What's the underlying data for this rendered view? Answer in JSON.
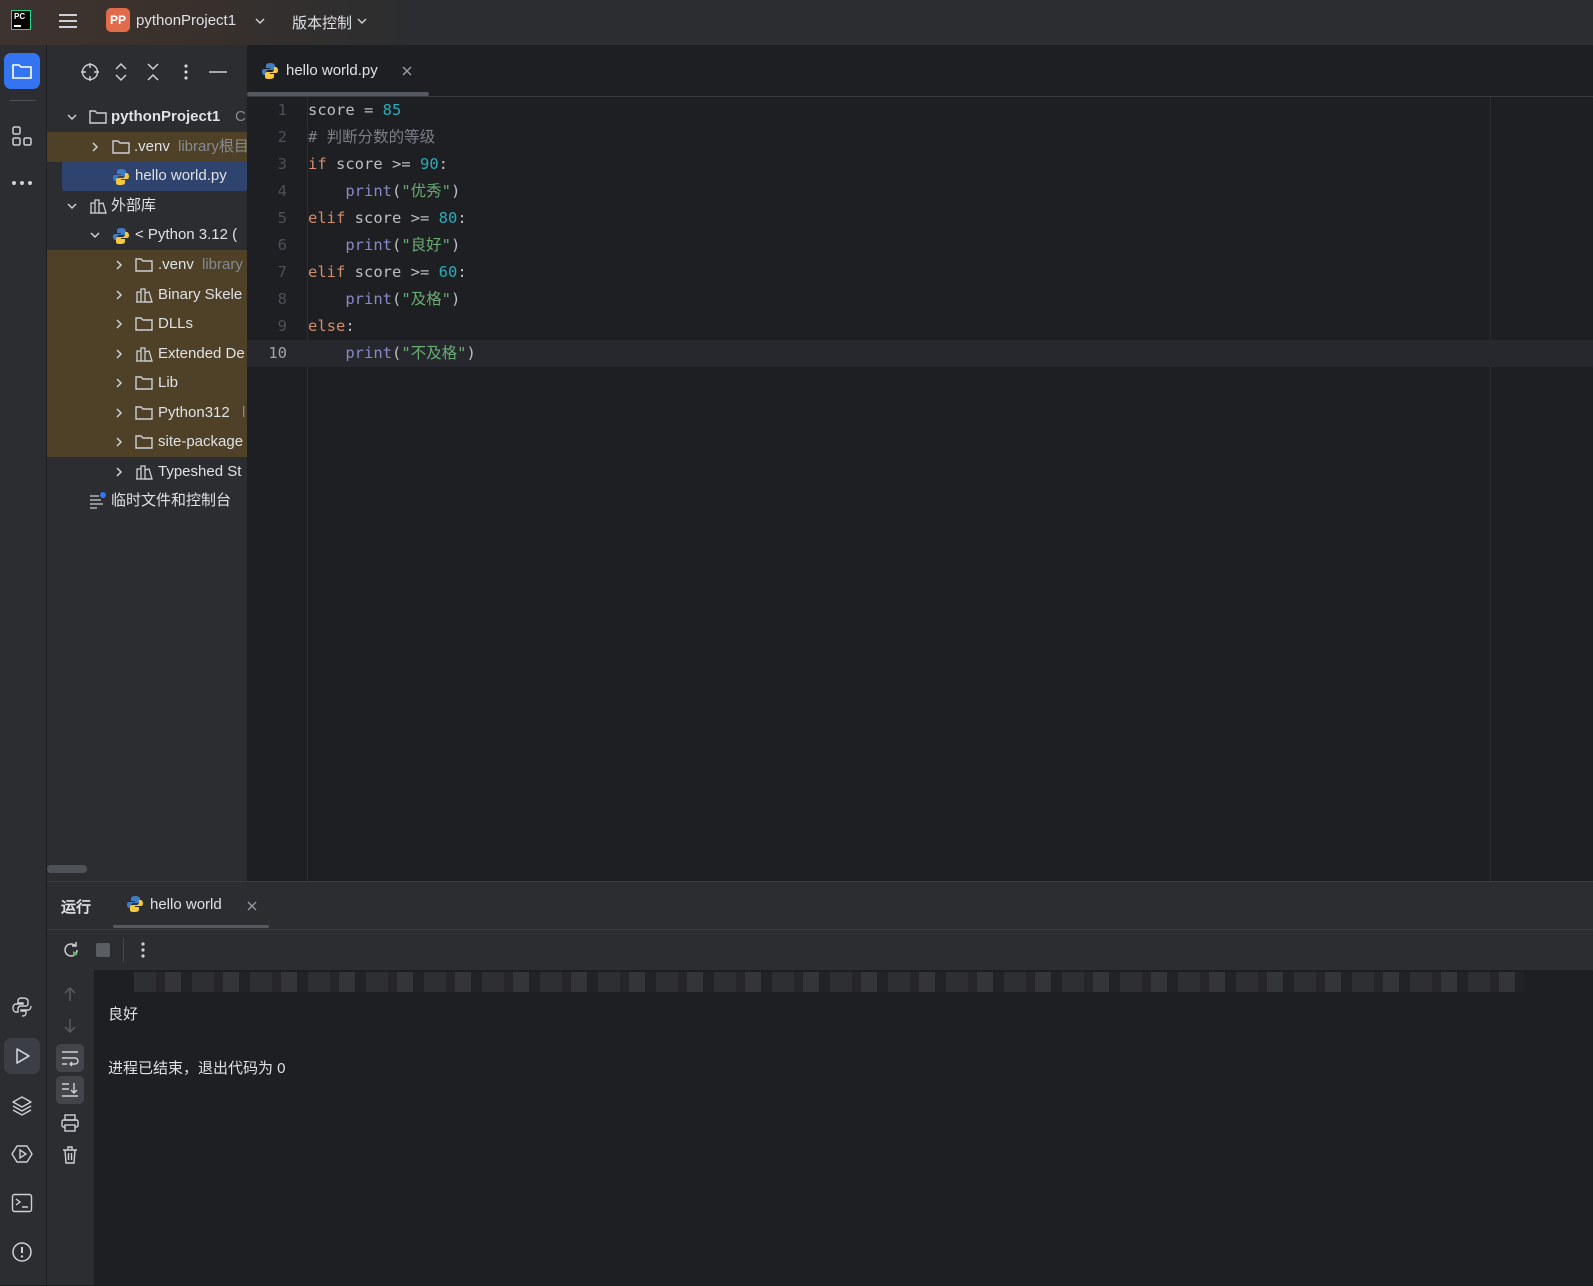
{
  "titlebar": {
    "logo_text": "PC",
    "project_badge": "PP",
    "project_name": "pythonProject1",
    "vcs_menu": "版本控制"
  },
  "project_tree": {
    "root": {
      "label": "pythonProject1",
      "suffix": "C"
    },
    "items": [
      {
        "label": ".venv",
        "suffix": "library根目"
      },
      {
        "label": "hello world.py"
      },
      {
        "label": "外部库"
      },
      {
        "label": "< Python 3.12 ("
      },
      {
        "label": ".venv",
        "suffix": "library"
      },
      {
        "label": "Binary Skele"
      },
      {
        "label": "DLLs"
      },
      {
        "label": "Extended De"
      },
      {
        "label": "Lib"
      },
      {
        "label": "Python312",
        "suffix": "l"
      },
      {
        "label": "site-package"
      },
      {
        "label": "Typeshed St"
      },
      {
        "label": "临时文件和控制台"
      }
    ]
  },
  "editor": {
    "tab_label": "hello world.py",
    "current_line": 10,
    "lines": [
      {
        "n": "1",
        "tokens": [
          [
            "pl",
            "score = "
          ],
          [
            "num",
            "85"
          ]
        ]
      },
      {
        "n": "2",
        "tokens": [
          [
            "cm",
            "# 判断分数的等级"
          ]
        ]
      },
      {
        "n": "3",
        "tokens": [
          [
            "kw",
            "if"
          ],
          [
            "pl",
            " score >= "
          ],
          [
            "num",
            "90"
          ],
          [
            "pl",
            ":"
          ]
        ]
      },
      {
        "n": "4",
        "tokens": [
          [
            "pl",
            "    "
          ],
          [
            "fn",
            "print"
          ],
          [
            "pl",
            "("
          ],
          [
            "str",
            "\"优秀\""
          ],
          [
            "pl",
            ")"
          ]
        ]
      },
      {
        "n": "5",
        "tokens": [
          [
            "kw",
            "elif"
          ],
          [
            "pl",
            " score >= "
          ],
          [
            "num",
            "80"
          ],
          [
            "pl",
            ":"
          ]
        ]
      },
      {
        "n": "6",
        "tokens": [
          [
            "pl",
            "    "
          ],
          [
            "fn",
            "print"
          ],
          [
            "pl",
            "("
          ],
          [
            "str",
            "\"良好\""
          ],
          [
            "pl",
            ")"
          ]
        ]
      },
      {
        "n": "7",
        "tokens": [
          [
            "kw",
            "elif"
          ],
          [
            "pl",
            " score >= "
          ],
          [
            "num",
            "60"
          ],
          [
            "pl",
            ":"
          ]
        ]
      },
      {
        "n": "8",
        "tokens": [
          [
            "pl",
            "    "
          ],
          [
            "fn",
            "print"
          ],
          [
            "pl",
            "("
          ],
          [
            "str",
            "\"及格\""
          ],
          [
            "pl",
            ")"
          ]
        ]
      },
      {
        "n": "9",
        "tokens": [
          [
            "kw",
            "else"
          ],
          [
            "pl",
            ":"
          ]
        ]
      },
      {
        "n": "10",
        "tokens": [
          [
            "pl",
            "    "
          ],
          [
            "fn",
            "print"
          ],
          [
            "pl",
            "("
          ],
          [
            "str",
            "\"不及格\""
          ],
          [
            "pl",
            ")"
          ]
        ]
      }
    ]
  },
  "run": {
    "panel_title": "运行",
    "tab_label": "hello world",
    "output_line": "良好",
    "exit_message": "进程已结束，退出代码为 0"
  },
  "colors": {
    "accent": "#3574f0",
    "keyword": "#cf8e6d",
    "number": "#2aacb8",
    "string": "#6aab73",
    "builtin": "#8888c6",
    "comment": "#7a7e85"
  }
}
